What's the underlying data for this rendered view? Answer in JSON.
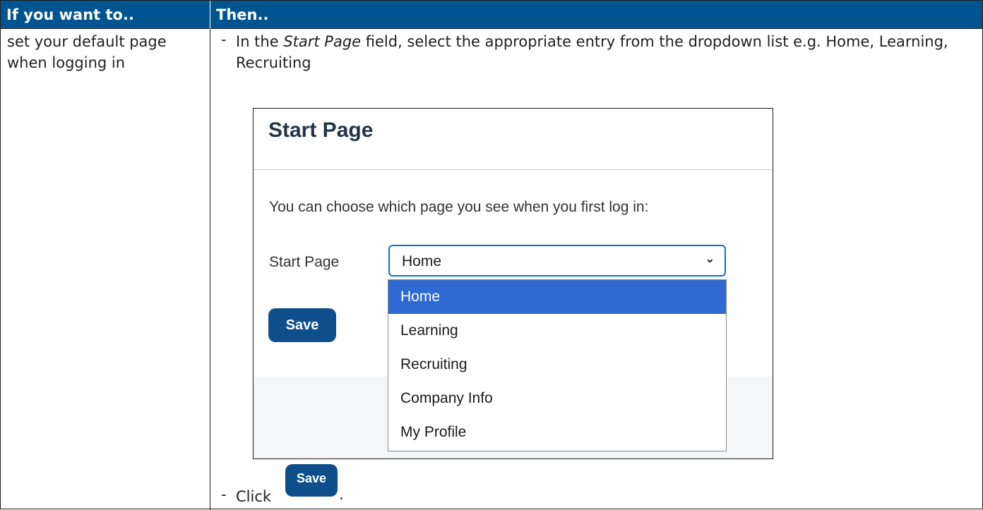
{
  "table": {
    "header": {
      "col1": "If you want to..",
      "col2": "Then.."
    },
    "row": {
      "condition": "set your default page when logging in",
      "step1": {
        "dash": "-",
        "before": "In the ",
        "field": "Start Page",
        "after": " field, select the appropriate entry from the dropdown list e.g. Home, Learning, Recruiting"
      },
      "step2": {
        "dash": "-",
        "before": "Click ",
        "after": "."
      }
    }
  },
  "screenshot": {
    "title": "Start Page",
    "description": "You can choose which page you see when you first log in:",
    "field_label": "Start Page",
    "selected_value": "Home",
    "options": [
      "Home",
      "Learning",
      "Recruiting",
      "Company Info",
      "My Profile"
    ],
    "save_label": "Save",
    "chevron": "chevron-down-icon"
  },
  "inline_button": {
    "label": "Save"
  },
  "colors": {
    "header_bg": "#00548f",
    "selected_option": "#2e6ad1",
    "button": "#0e4f8b"
  }
}
